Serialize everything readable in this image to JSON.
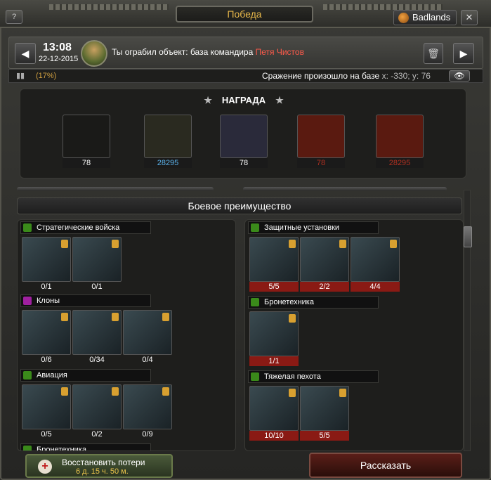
{
  "window": {
    "title": "Победа",
    "help": "?",
    "server": "Badlands",
    "close": "✕"
  },
  "header": {
    "time": "13:08",
    "date": "22-12-2015",
    "message": "Ты ограбил объект: база командира",
    "player": "Петя Чистов",
    "prev": "◀",
    "next": "▶",
    "trash": "🗑"
  },
  "subbar": {
    "percent": "(17%)",
    "battle": "Сражение произошло на базе",
    "coords": "x: -330; y: 76",
    "eye": "👁"
  },
  "reward": {
    "title": "НАГРАДА",
    "star": "★",
    "items": [
      {
        "icon": "laurel-star-icon",
        "value": "78",
        "color": "#fff",
        "bg": "#1a1a18"
      },
      {
        "icon": "resource-crates-icon",
        "value": "28295",
        "color": "#5ab0e8",
        "bg": "#2a2a20"
      },
      {
        "icon": "star-medal-icon",
        "value": "78",
        "color": "#fff",
        "bg": "#2a2a3a"
      },
      {
        "icon": "target-icon",
        "value": "78",
        "color": "#b03020",
        "bg": "#5a1a10"
      },
      {
        "icon": "money-bags-icon",
        "value": "28295",
        "color": "#b03020",
        "bg": "#5a1a10"
      }
    ]
  },
  "advantage": {
    "title": "Боевое преимущество"
  },
  "left": {
    "sections": [
      {
        "title": "Стратегические войска",
        "color": "#3a8a1a",
        "units": [
          {
            "count": "0/1",
            "img": "tank-icon"
          },
          {
            "count": "0/1",
            "img": "heavy-tank-icon"
          }
        ]
      },
      {
        "title": "Клоны",
        "color": "#a020a0",
        "units": [
          {
            "count": "0/6",
            "img": "alien-icon"
          },
          {
            "count": "0/34",
            "img": "alien-head-icon"
          },
          {
            "count": "0/4",
            "img": "alien-warrior-icon"
          }
        ]
      },
      {
        "title": "Авиация",
        "color": "#3a8a1a",
        "units": [
          {
            "count": "0/5",
            "img": "helicopter-icon"
          },
          {
            "count": "0/2",
            "img": "attack-helicopter-icon"
          },
          {
            "count": "0/9",
            "img": "camo-helicopter-icon"
          }
        ]
      },
      {
        "title": "Бронетехника",
        "color": "#3a8a1a",
        "units": []
      }
    ]
  },
  "right": {
    "sections": [
      {
        "title": "Защитные установки",
        "color": "#3a8a1a",
        "units": [
          {
            "count": "5/5",
            "img": "turret-icon"
          },
          {
            "count": "2/2",
            "img": "bunker-icon"
          },
          {
            "count": "4/4",
            "img": "cannon-icon"
          }
        ]
      },
      {
        "title": "Бронетехника",
        "color": "#3a8a1a",
        "units": [
          {
            "count": "1/1",
            "img": "humvee-icon"
          }
        ]
      },
      {
        "title": "Тяжелая пехота",
        "color": "#3a8a1a",
        "units": [
          {
            "count": "10/10",
            "img": "heavy-soldier-icon"
          },
          {
            "count": "5/5",
            "img": "ghillie-soldier-icon"
          }
        ]
      }
    ]
  },
  "buttons": {
    "restore_line1": "Восстановить потери",
    "restore_line2": "6 д. 15 ч. 50 м.",
    "tell": "Рассказать",
    "cross": "+"
  }
}
